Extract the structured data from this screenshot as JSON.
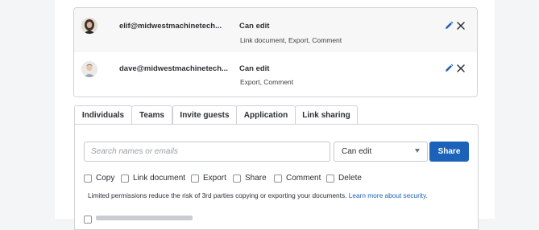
{
  "users": [
    {
      "email": "elif@midwestmachinetech...",
      "permission": "Can edit",
      "details": "Link document, Export, Comment"
    },
    {
      "email": "dave@midwestmachinetech...",
      "permission": "Can edit",
      "details": "Export, Comment"
    }
  ],
  "tabs": [
    "Individuals",
    "Teams",
    "Invite guests",
    "Application",
    "Link sharing"
  ],
  "invite": {
    "search_placeholder": "Search names or emails",
    "permission_selected": "Can edit",
    "share_label": "Share"
  },
  "restrictions": [
    "Copy",
    "Link document",
    "Export",
    "Share",
    "Comment",
    "Delete"
  ],
  "info": {
    "text": "Limited permissions reduce the risk of 3rd parties copying or exporting your documents.",
    "link": "Learn more about security."
  },
  "colors": {
    "accent": "#1b62b8",
    "border": "#cfd3d7",
    "text": "#2b2f33",
    "background": "#f4f5f6"
  }
}
